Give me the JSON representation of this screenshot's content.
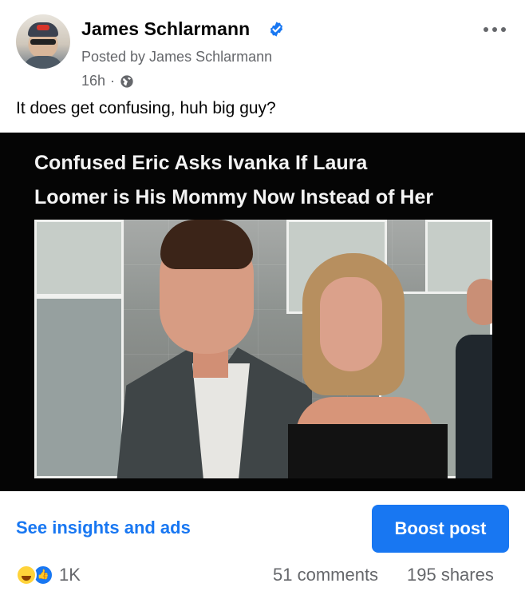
{
  "post": {
    "author": "James Schlarmann",
    "posted_by": "Posted by James Schlarmann",
    "time": "16h",
    "separator": "·",
    "caption": "It does get confusing, huh big guy?"
  },
  "image": {
    "headline_line1": "Confused Eric Asks Ivanka If Laura",
    "headline_line2": "Loomer is His Mommy Now Instead of Her"
  },
  "actions": {
    "insights": "See insights and ads",
    "boost": "Boost post"
  },
  "footer": {
    "reaction_count": "1K",
    "comments": "51 comments",
    "shares": "195 shares"
  },
  "colors": {
    "accent": "#1877f2",
    "secondary_text": "#65676b"
  },
  "icons": {
    "verified": "verified-badge",
    "privacy": "globe-icon",
    "more": "more-horizontal-icon",
    "reactions": [
      "haha-reaction-icon",
      "like-reaction-icon"
    ]
  }
}
